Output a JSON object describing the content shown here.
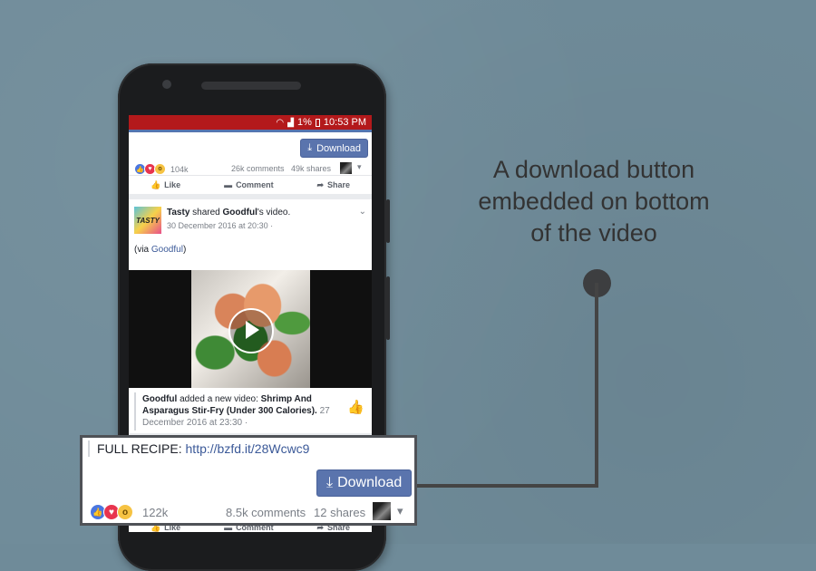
{
  "status_bar": {
    "battery": "1%",
    "time": "10:53 PM"
  },
  "top_post": {
    "download_label": "Download",
    "reaction_count": "104k",
    "comments": "26k comments",
    "shares": "49k shares"
  },
  "actions": {
    "like": "Like",
    "comment": "Comment",
    "share": "Share"
  },
  "tasty_post": {
    "avatar_text": "TASTY",
    "author": "Tasty",
    "shared_text": "shared",
    "source": "Goodful",
    "source_suffix": "'s video.",
    "timestamp": "30 December 2016 at 20:30 ·",
    "via_prefix": "(via ",
    "via_link": "Goodful",
    "via_suffix": ")"
  },
  "embedded_post": {
    "author": "Goodful",
    "text": "added a new video:",
    "title": "Shrimp And Asparagus Stir-Fry (Under 300 Calories).",
    "date_part1": "27",
    "date_part2": "December 2016 at 23:30 ·"
  },
  "callout": {
    "recipe_label": "FULL RECIPE:",
    "recipe_link": "http://bzfd.it/28Wcwc9",
    "download_label": "Download",
    "reaction_count": "122k",
    "comments": "8.5k comments",
    "shares": "12 shares"
  },
  "caption": {
    "line1": "A download button",
    "line2": "embedded on bottom",
    "line3": "of the video"
  },
  "colors": {
    "background": "#6f8b99",
    "status_bar": "#b3191b",
    "download_button": "#5a74ad",
    "link": "#3b5998"
  }
}
